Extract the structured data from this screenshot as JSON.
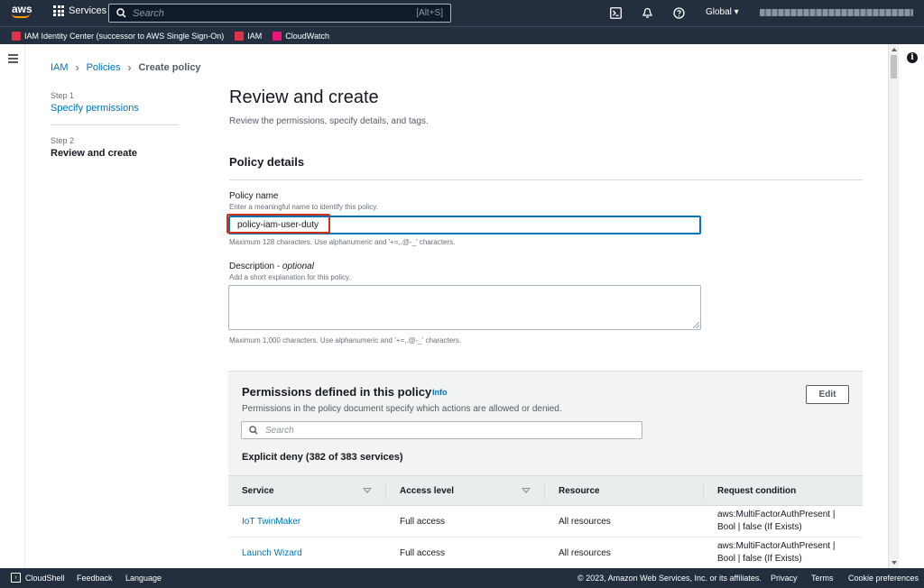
{
  "topnav": {
    "logo_text": "aws",
    "services_label": "Services",
    "search_placeholder": "Search",
    "search_shortcut": "[Alt+S]",
    "region": "Global ▾",
    "icons": [
      "cloudshell-icon",
      "bell-icon",
      "help-icon"
    ]
  },
  "favorites": [
    {
      "label": "IAM Identity Center (successor to AWS Single Sign-On)",
      "color": "#dd344c"
    },
    {
      "label": "IAM",
      "color": "#dd344c"
    },
    {
      "label": "CloudWatch",
      "color": "#e7157b"
    }
  ],
  "breadcrumb": {
    "items": [
      "IAM",
      "Policies"
    ],
    "current": "Create policy"
  },
  "steps": {
    "step1_label": "Step 1",
    "step1_title": "Specify permissions",
    "step2_label": "Step 2",
    "step2_title": "Review and create"
  },
  "page": {
    "title": "Review and create",
    "description": "Review the permissions, specify details, and tags."
  },
  "policy_details": {
    "title": "Policy details",
    "name_label": "Policy name",
    "name_desc": "Enter a meaningful name to identify this policy.",
    "name_value": "policy-iam-user-duty",
    "name_hint": "Maximum 128 characters. Use alphanumeric and '+=,.@-_' characters.",
    "desc_label": "Description",
    "desc_optional": " - optional",
    "desc_desc": "Add a short explanation for this policy.",
    "desc_value": "",
    "desc_hint": "Maximum 1,000 characters. Use alphanumeric and '+=,.@-_' characters."
  },
  "permissions": {
    "title": "Permissions defined in this policy",
    "info": "Info",
    "description": "Permissions in the policy document specify which actions are allowed or denied.",
    "edit_label": "Edit",
    "search_placeholder": "Search",
    "deny_title": "Explicit deny (382 of 383 services)",
    "columns": [
      "Service",
      "Access level",
      "Resource",
      "Request condition"
    ],
    "rows": [
      {
        "service": "IoT TwinMaker",
        "access": "Full access",
        "resource": "All resources",
        "cond1": "aws:MultiFactorAuthPresent |",
        "cond2": "Bool | false (If Exists)"
      },
      {
        "service": "Launch Wizard",
        "access": "Full access",
        "resource": "All resources",
        "cond1": "aws:MultiFactorAuthPresent |",
        "cond2": "Bool | false (If Exists)"
      }
    ]
  },
  "footer": {
    "cloudshell": "CloudShell",
    "feedback": "Feedback",
    "language": "Language",
    "copyright": "© 2023, Amazon Web Services, Inc. or its affiliates.",
    "privacy": "Privacy",
    "terms": "Terms",
    "cookie": "Cookie preferences"
  }
}
